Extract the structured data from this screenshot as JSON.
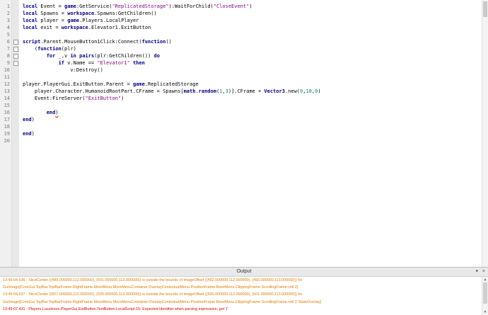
{
  "editor": {
    "line_numbers": [
      "1",
      "2",
      "3",
      "4",
      "5",
      "6",
      "7",
      "8",
      "9",
      "10",
      "11",
      "12",
      "13",
      "14",
      "15",
      "16",
      "17",
      "18",
      "19",
      "20"
    ],
    "fold_markers": {
      "6": "-",
      "7": "-",
      "8": "-",
      "9": "-"
    },
    "lines": [
      [
        {
          "t": "local",
          "c": "kw"
        },
        {
          "t": " Event = "
        },
        {
          "t": "game",
          "c": "kw"
        },
        {
          "t": ":GetService("
        },
        {
          "t": "\"ReplicatedStorage\"",
          "c": "str"
        },
        {
          "t": "):WaitForChild("
        },
        {
          "t": "\"CloseEvent\"",
          "c": "str"
        },
        {
          "t": ")"
        }
      ],
      [
        {
          "t": "local",
          "c": "kw"
        },
        {
          "t": " Spawns = "
        },
        {
          "t": "workspace",
          "c": "kw"
        },
        {
          "t": ".Spawns:GetChildren()"
        }
      ],
      [
        {
          "t": "local",
          "c": "kw"
        },
        {
          "t": " player = "
        },
        {
          "t": "game",
          "c": "kw"
        },
        {
          "t": ".Players.LocalPlayer"
        }
      ],
      [
        {
          "t": "local",
          "c": "kw"
        },
        {
          "t": " exit = "
        },
        {
          "t": "workspace",
          "c": "kw"
        },
        {
          "t": ".Elevator1.ExitButton"
        }
      ],
      [],
      [
        {
          "t": "script",
          "c": "kw"
        },
        {
          "t": ".Parent.MouseButton1Click:Connect("
        },
        {
          "t": "function",
          "c": "kw"
        },
        {
          "t": "()"
        }
      ],
      [
        {
          "t": "    ("
        },
        {
          "t": "function",
          "c": "kw"
        },
        {
          "t": "(plr)"
        }
      ],
      [
        {
          "t": "        "
        },
        {
          "t": "for",
          "c": "kw"
        },
        {
          "t": " _,v "
        },
        {
          "t": "in",
          "c": "kw"
        },
        {
          "t": " "
        },
        {
          "t": "pairs",
          "c": "fn"
        },
        {
          "t": "(plr:GetChildren()) "
        },
        {
          "t": "do",
          "c": "kw"
        }
      ],
      [
        {
          "t": "            "
        },
        {
          "t": "if",
          "c": "kw"
        },
        {
          "t": " v.Name == "
        },
        {
          "t": "\"Elevator1\"",
          "c": "str"
        },
        {
          "t": " "
        },
        {
          "t": "then",
          "c": "kw"
        }
      ],
      [
        {
          "t": "                v:Destroy()"
        }
      ],
      [],
      [
        {
          "t": "player.PlayerGui.ExitButton.Parent = "
        },
        {
          "t": "game",
          "c": "kw"
        },
        {
          "t": ".ReplicatedStorage"
        }
      ],
      [
        {
          "t": "    player.Character.HumanoidRootPart.CFrame = Spawns["
        },
        {
          "t": "math",
          "c": "kw"
        },
        {
          "t": "."
        },
        {
          "t": "random",
          "c": "fn"
        },
        {
          "t": "("
        },
        {
          "t": "1",
          "c": "num"
        },
        {
          "t": ","
        },
        {
          "t": "3",
          "c": "num"
        },
        {
          "t": ")].CFrame + "
        },
        {
          "t": "Vector3",
          "c": "kw"
        },
        {
          "t": ".new("
        },
        {
          "t": "0",
          "c": "num"
        },
        {
          "t": ","
        },
        {
          "t": "10",
          "c": "num"
        },
        {
          "t": ","
        },
        {
          "t": "0",
          "c": "num"
        },
        {
          "t": ")"
        }
      ],
      [
        {
          "t": "    Event:FireServer("
        },
        {
          "t": "\"ExitButton\"",
          "c": "str"
        },
        {
          "t": ")"
        }
      ],
      [],
      [
        {
          "t": "        "
        },
        {
          "t": "end",
          "c": "kw"
        },
        {
          "t": ")",
          "c": "caret-err"
        }
      ],
      [
        {
          "t": "end",
          "c": "kw"
        },
        {
          "t": ")"
        }
      ],
      [],
      [
        {
          "t": "end",
          "c": "kw"
        },
        {
          "t": ")"
        }
      ],
      []
    ]
  },
  "output": {
    "title": "Output",
    "controls": [
      "▾",
      "×"
    ],
    "messages": [
      {
        "level": "warn",
        "text": "13:49:04.636 - SliceCenter ((499.000000,112.000000), (501.000000,113.000000)) is outside the bounds of imageOffset ((492.000000,112.000000), (493.000000,113.000000)) for"
      },
      {
        "level": "warn",
        "text": "GuiImage[CoreGui.TopBar.TopBarFrame.RightFrame.MoreMenu.MoreMenuContainer.OverlayContextualMenu.PositionFrame.BaseMenu.ClippingFrame.ScrollingFrame.cell 2]"
      },
      {
        "level": "warn",
        "text": "13:49:04.637 - SliceCenter ((507.000000,112.000000), (509.000000,113.000000)) is outside the bounds of imageOffset ((500.000000,112.000000), (501.000000,113.000000)) for"
      },
      {
        "level": "warn",
        "text": "GuiImage[CoreGui.TopBar.TopBarFrame.RightFrame.MoreMenu.MoreMenuContainer.OverlayContextualMenu.PositionFrame.BaseMenu.ClippingFrame.ScrollingFrame.cell 2.StateOverlay]"
      },
      {
        "level": "err",
        "text": "13:49:07.431 - Players.Luculence.PlayerGui.ExitButton.TextButton.LocalScript:15: Expected identifier when parsing expression, got ')'"
      }
    ]
  }
}
